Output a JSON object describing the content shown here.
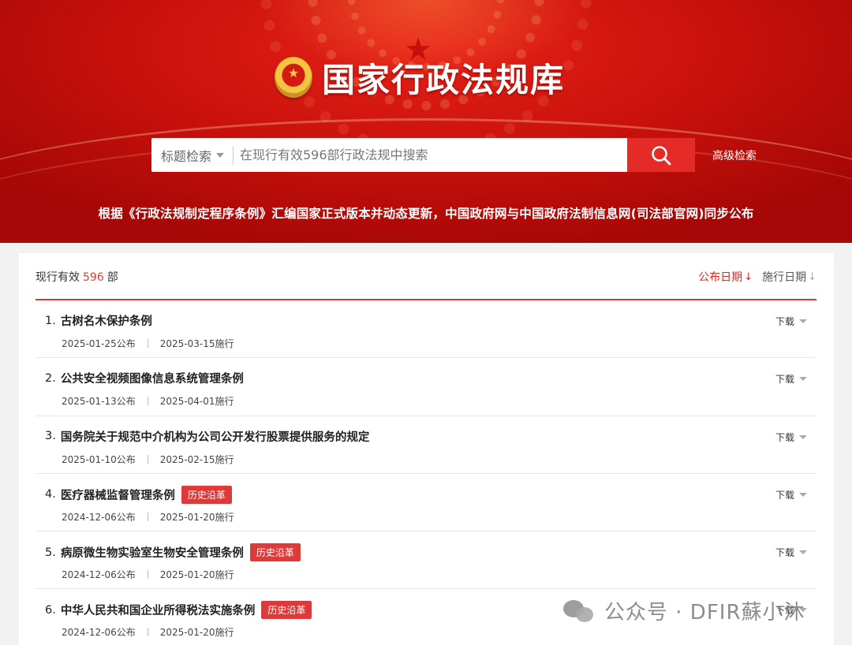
{
  "header": {
    "site_title": "国家行政法规库",
    "search_type": "标题检索",
    "search_placeholder": "在现行有效596部行政法规中搜索",
    "advanced_search": "高级检索",
    "tagline": "根据《行政法规制定程序条例》汇编国家正式版本并动态更新，中国政府网与中国政府法制信息网(司法部官网)同步公布"
  },
  "summary": {
    "prefix": "现行有效",
    "count": "596",
    "suffix": "部"
  },
  "sort": {
    "publish_date": "公布日期",
    "effective_date": "施行日期"
  },
  "download_label": "下载",
  "history_label": "历史沿革",
  "items": [
    {
      "index": "1.",
      "title": "古树名木保护条例",
      "published": "2025-01-25公布",
      "effective": "2025-03-15施行",
      "history": false
    },
    {
      "index": "2.",
      "title": "公共安全视频图像信息系统管理条例",
      "published": "2025-01-13公布",
      "effective": "2025-04-01施行",
      "history": false
    },
    {
      "index": "3.",
      "title": "国务院关于规范中介机构为公司公开发行股票提供服务的规定",
      "published": "2025-01-10公布",
      "effective": "2025-02-15施行",
      "history": false
    },
    {
      "index": "4.",
      "title": "医疗器械监督管理条例",
      "published": "2024-12-06公布",
      "effective": "2025-01-20施行",
      "history": true
    },
    {
      "index": "5.",
      "title": "病原微生物实验室生物安全管理条例",
      "published": "2024-12-06公布",
      "effective": "2025-01-20施行",
      "history": true
    },
    {
      "index": "6.",
      "title": "中华人民共和国企业所得税法实施条例",
      "published": "2024-12-06公布",
      "effective": "2025-01-20施行",
      "history": true
    }
  ],
  "watermark": "公众号 · DFIR蘇小沐",
  "colors": {
    "brand_red": "#e52b28",
    "accent_red": "#d72a24",
    "badge_red": "#df3a3a"
  }
}
